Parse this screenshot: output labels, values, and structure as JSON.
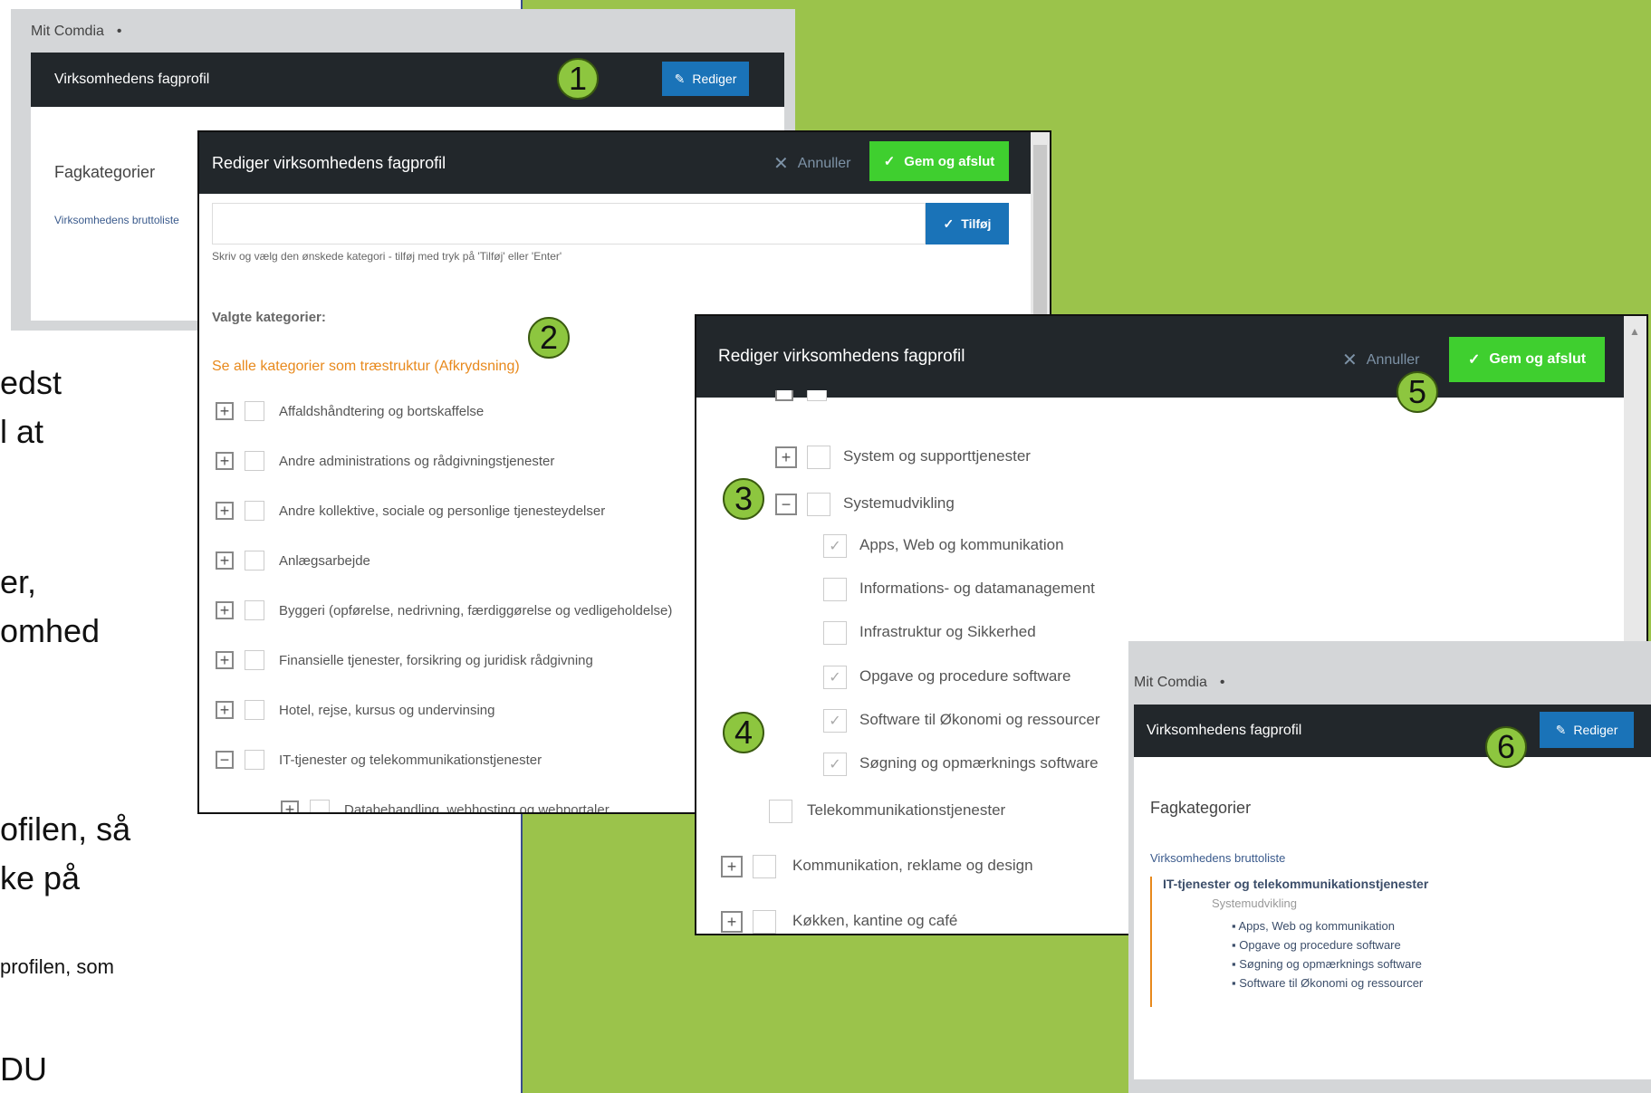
{
  "background_text": [
    "edst",
    "l at",
    "er,",
    "omhed",
    "ofilen, så",
    "ke på",
    "profilen, som",
    "DU"
  ],
  "badges": [
    "1",
    "2",
    "3",
    "4",
    "5",
    "6"
  ],
  "panel1": {
    "breadcrumb": "Mit Comdia",
    "breadcrumb_dot": "•",
    "header_title": "Virksomhedens fagprofil",
    "edit_button": "Rediger",
    "section_title": "Fagkategorier",
    "link": "Virksomhedens bruttoliste"
  },
  "modal1": {
    "title": "Rediger virksomhedens fagprofil",
    "cancel": "Annuller",
    "save": "Gem og afslut",
    "input_value": "",
    "add_button": "Tilføj",
    "hint": "Skriv og vælg den ønskede kategori - tilføj med tryk på 'Tilføj' eller 'Enter'",
    "selected_label": "Valgte kategorier:",
    "tree_link": "Se alle kategorier som træstruktur (Afkrydsning)",
    "categories": [
      {
        "expander": "+",
        "label": "Affaldshåndtering og bortskaffelse"
      },
      {
        "expander": "+",
        "label": "Andre administrations og rådgivningstjenester"
      },
      {
        "expander": "+",
        "label": "Andre kollektive, sociale og personlige tjenesteydelser"
      },
      {
        "expander": "+",
        "label": "Anlægsarbejde"
      },
      {
        "expander": "+",
        "label": "Byggeri (opførelse, nedrivning, færdiggørelse og vedligeholdelse)"
      },
      {
        "expander": "+",
        "label": "Finansielle tjenester, forsikring og juridisk rådgivning"
      },
      {
        "expander": "+",
        "label": "Hotel, rejse, kursus og undervinsing"
      },
      {
        "expander": "−",
        "label": "IT-tjenester og telekommunikationstjenester"
      },
      {
        "expander": "+",
        "label": "Databehandling, webhosting og webportaler"
      }
    ]
  },
  "modal2": {
    "title": "Rediger virksomhedens fagprofil",
    "cancel": "Annuller",
    "save": "Gem og afslut",
    "rows": [
      {
        "expander": "+",
        "checked": false,
        "label": "System og supporttjenester"
      },
      {
        "expander": "−",
        "checked": false,
        "label": "Systemudvikling"
      },
      {
        "expander": "",
        "checked": true,
        "label": "Apps, Web og kommunikation"
      },
      {
        "expander": "",
        "checked": false,
        "label": "Informations- og datamanagement"
      },
      {
        "expander": "",
        "checked": false,
        "label": "Infrastruktur og Sikkerhed"
      },
      {
        "expander": "",
        "checked": true,
        "label": "Opgave og procedure software"
      },
      {
        "expander": "",
        "checked": true,
        "label": "Software til Økonomi og ressourcer"
      },
      {
        "expander": "",
        "checked": true,
        "label": "Søgning og opmærknings software"
      },
      {
        "expander": "",
        "checked": false,
        "label": "Telekommunikationstjenester"
      },
      {
        "expander": "+",
        "checked": false,
        "label": "Kommunikation, reklame og design"
      },
      {
        "expander": "+",
        "checked": false,
        "label": "Køkken, kantine og café"
      }
    ]
  },
  "panel6": {
    "breadcrumb": "Mit Comdia",
    "breadcrumb_dot": "•",
    "header_title": "Virksomhedens fagprofil",
    "edit_button": "Rediger",
    "section_title": "Fagkategorier",
    "link": "Virksomhedens bruttoliste",
    "category": "IT-tjenester og telekommunikationstjenester",
    "subcategory": "Systemudvikling",
    "items": [
      "Apps, Web og kommunikation",
      "Opgave og procedure software",
      "Søgning og opmærknings software",
      "Software til Økonomi og ressourcer"
    ]
  },
  "colors": {
    "green_bg": "#9bc34b",
    "dark_header": "#22272b",
    "blue_button": "#1a73b8",
    "green_button": "#3fcf2f",
    "orange_link": "#e8891c"
  },
  "icons": [
    "edit-icon",
    "close-icon",
    "check-icon",
    "plus-box-icon",
    "minus-box-icon",
    "checkbox-icon"
  ]
}
